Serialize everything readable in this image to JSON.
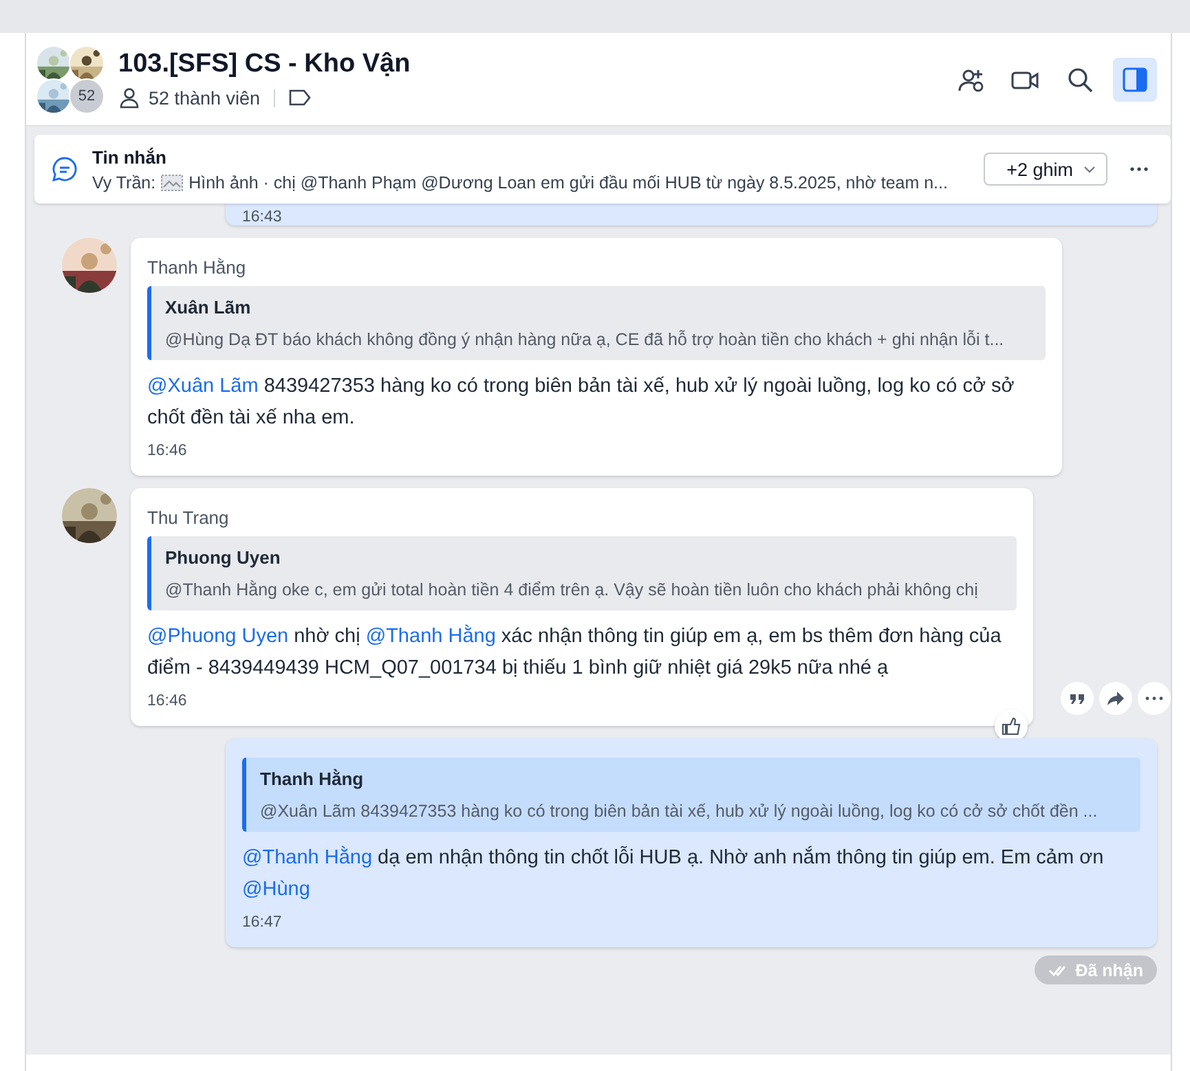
{
  "conversation": {
    "title": "103.[SFS] CS - Kho Vận",
    "avatar_count": "52",
    "members": "52 thành viên"
  },
  "header_actions": [
    {
      "kind": "add-member",
      "selected": false
    },
    {
      "kind": "video",
      "selected": false
    },
    {
      "kind": "search",
      "selected": false
    },
    {
      "kind": "sidebar",
      "selected": true
    }
  ],
  "pinned": {
    "label": "Tin nhắn",
    "sender": "Vy Trần:",
    "preview": "Hình ảnh · chị @Thanh Phạm @Dương Loan em gửi đầu mối HUB từ ngày 8.5.2025, nhờ team n...",
    "pins_button": "+2 ghim"
  },
  "messages": [
    {
      "kind": "own",
      "time": "16:43",
      "show_actions": false
    },
    {
      "kind": "incoming",
      "sender": "Thanh Hằng",
      "quote": {
        "author": "Xuân Lãm",
        "text": "@Hùng Dạ ĐT báo khách không đồng ý nhận hàng nữa ạ, CE đã hỗ trợ hoàn tiền cho khách + ghi nhận lỗi t..."
      },
      "body": [
        {
          "kind": "mention",
          "text": "@Xuân Lãm"
        },
        {
          "kind": "text",
          "text": " 8439427353 hàng ko có trong biên bản tài xế, hub xử lý ngoài luồng, log ko có cở sở chốt đền tài xế nha em."
        }
      ],
      "time": "16:46",
      "show_actions": false
    },
    {
      "kind": "incoming",
      "sender": "Thu Trang",
      "quote": {
        "author": "Phuong Uyen",
        "text": "@Thanh Hằng oke c, em gửi total hoàn tiền 4 điểm trên ạ. Vậy sẽ hoàn tiền luôn cho khách phải không chị"
      },
      "body": [
        {
          "kind": "mention",
          "text": "@Phuong Uyen"
        },
        {
          "kind": "text",
          "text": " nhờ chị "
        },
        {
          "kind": "mention",
          "text": "@Thanh Hằng"
        },
        {
          "kind": "text",
          "text": " xác nhận thông tin giúp em ạ, em bs thêm đơn hàng của điểm - 8439449439 HCM_Q07_001734 bị thiếu 1 bình giữ nhiệt giá 29k5 nữa nhé ạ"
        }
      ],
      "time": "16:46",
      "show_actions": true
    },
    {
      "kind": "own",
      "quote": {
        "author": "Thanh Hằng",
        "text": "@Xuân Lãm 8439427353 hàng ko có trong biên bản tài xế, hub xử lý ngoài luồng, log ko có cở sở chốt đền ..."
      },
      "body": [
        {
          "kind": "mention",
          "text": "@Thanh Hằng"
        },
        {
          "kind": "text",
          "text": " dạ em nhận thông tin chốt lỗi HUB ạ. Nhờ anh nắm thông tin giúp em. Em cảm ơn "
        },
        {
          "kind": "mention",
          "text": "@Hùng"
        }
      ],
      "time": "16:47",
      "receipt": "Đã nhận",
      "show_actions": false
    }
  ]
}
